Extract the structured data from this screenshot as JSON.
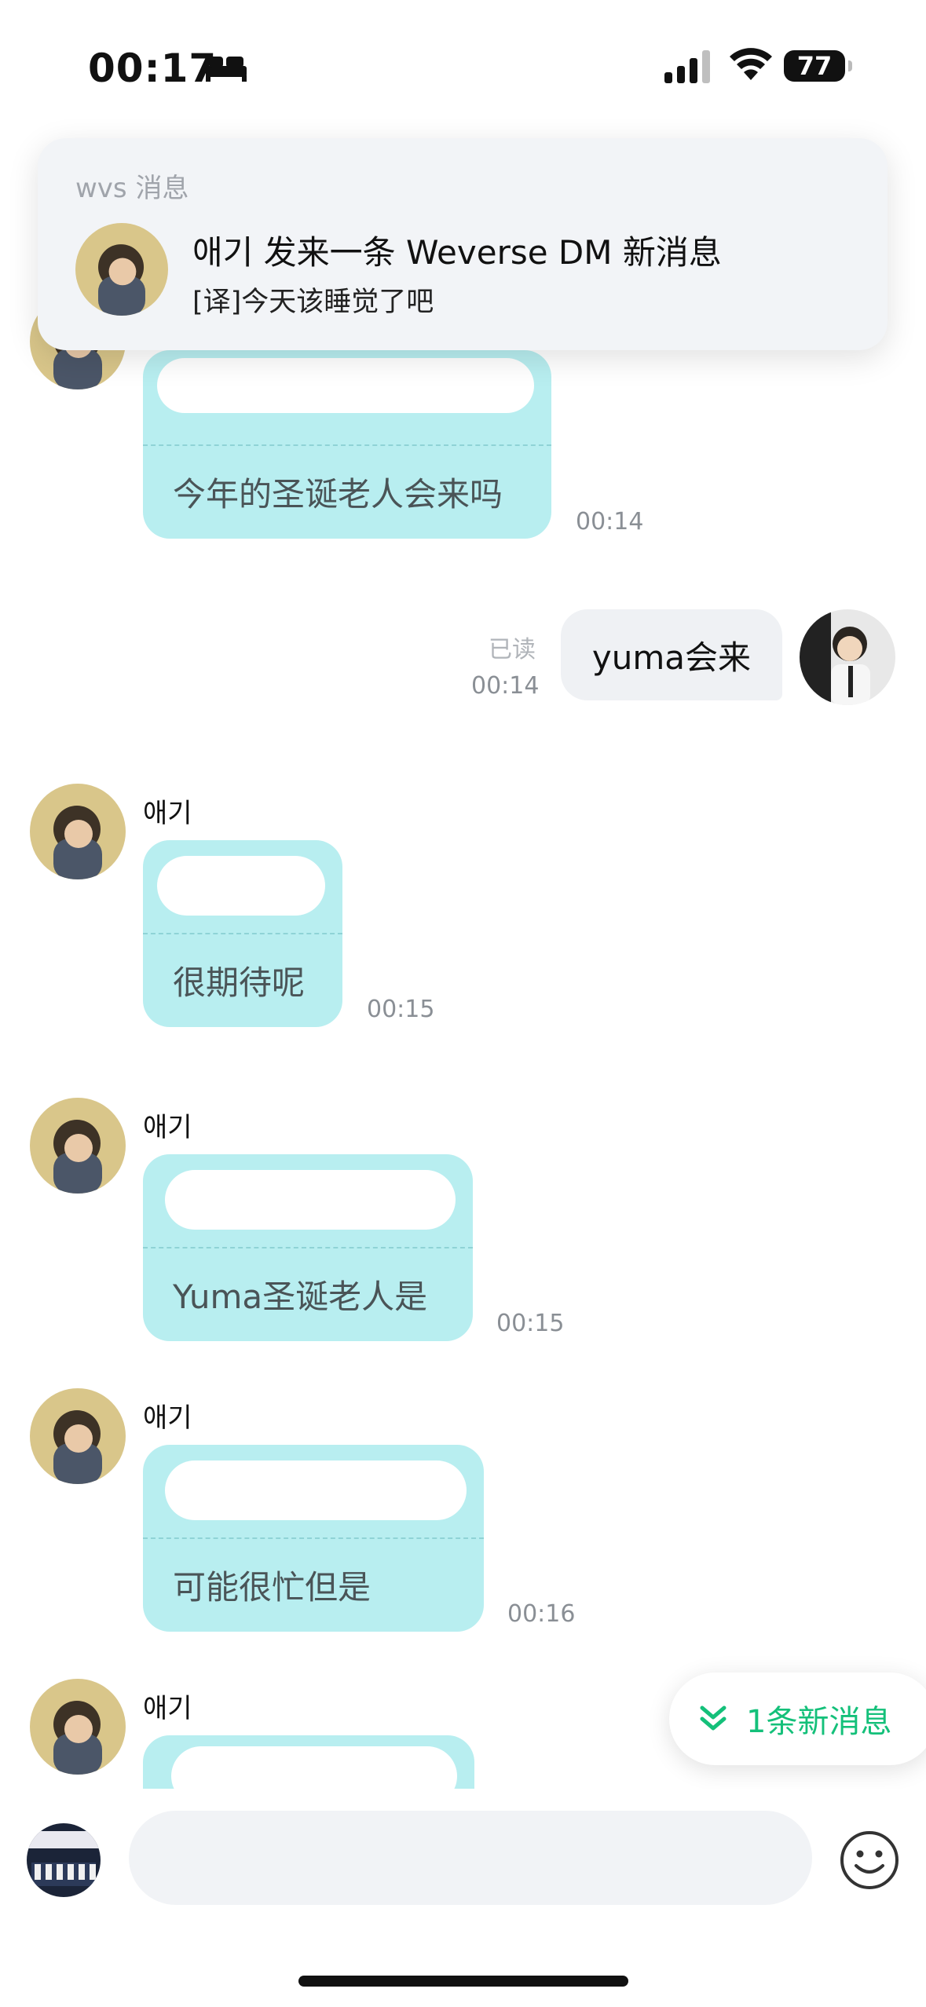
{
  "status_bar": {
    "time": "00:17",
    "battery": "77"
  },
  "notification": {
    "app": "wvs 消息",
    "title": "애기 发来一条 Weverse DM 新消息",
    "body": "[译]今天该睡觉了吧"
  },
  "messages": [
    {
      "sender": "",
      "text": "今年的圣诞老人会来吗",
      "time": "00:14"
    },
    {
      "sender": "me",
      "text": "yuma会来",
      "time": "00:14",
      "status": "已读"
    },
    {
      "sender": "애기",
      "text": "很期待呢",
      "time": "00:15"
    },
    {
      "sender": "애기",
      "text": "Yuma圣诞老人是",
      "time": "00:15"
    },
    {
      "sender": "애기",
      "text": "可能很忙但是",
      "time": "00:16"
    },
    {
      "sender": "애기",
      "text": "",
      "time": ""
    }
  ],
  "new_message_pill": "1条新消息",
  "colors": {
    "bubble": "#b8eef0",
    "accent": "#14c07a",
    "my_bubble": "#eff1f4"
  },
  "icons": [
    "bed-icon",
    "signal-icon",
    "wifi-icon",
    "battery-icon",
    "chevron-double-down-icon",
    "emoji-icon"
  ]
}
